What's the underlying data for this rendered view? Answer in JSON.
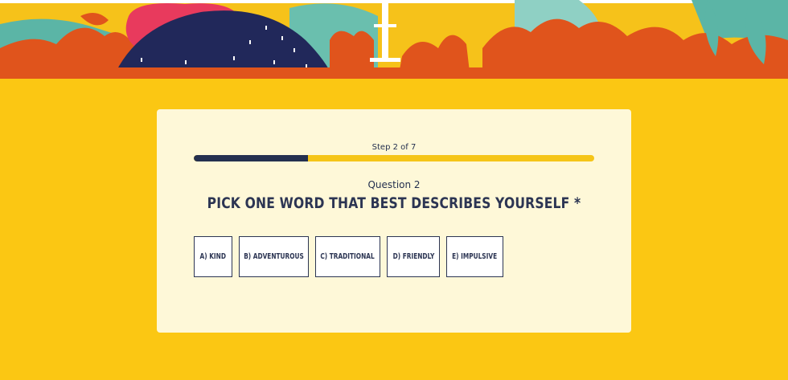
{
  "form": {
    "step_label": "Step 2 of 7",
    "progress": 0.286,
    "question_number": "Question 2",
    "question_title": "PICK ONE WORD THAT BEST DESCRIBES YOURSELF *",
    "options": [
      {
        "label": "A) KIND"
      },
      {
        "label": "B) ADVENTUROUS"
      },
      {
        "label": "C) TRADITIONAL"
      },
      {
        "label": "D) FRIENDLY"
      },
      {
        "label": "E) IMPULSIVE"
      }
    ]
  },
  "colors": {
    "background": "#fbc713",
    "card": "#fef8d8",
    "navy": "#24304f",
    "progress_track": "#f5c518"
  }
}
